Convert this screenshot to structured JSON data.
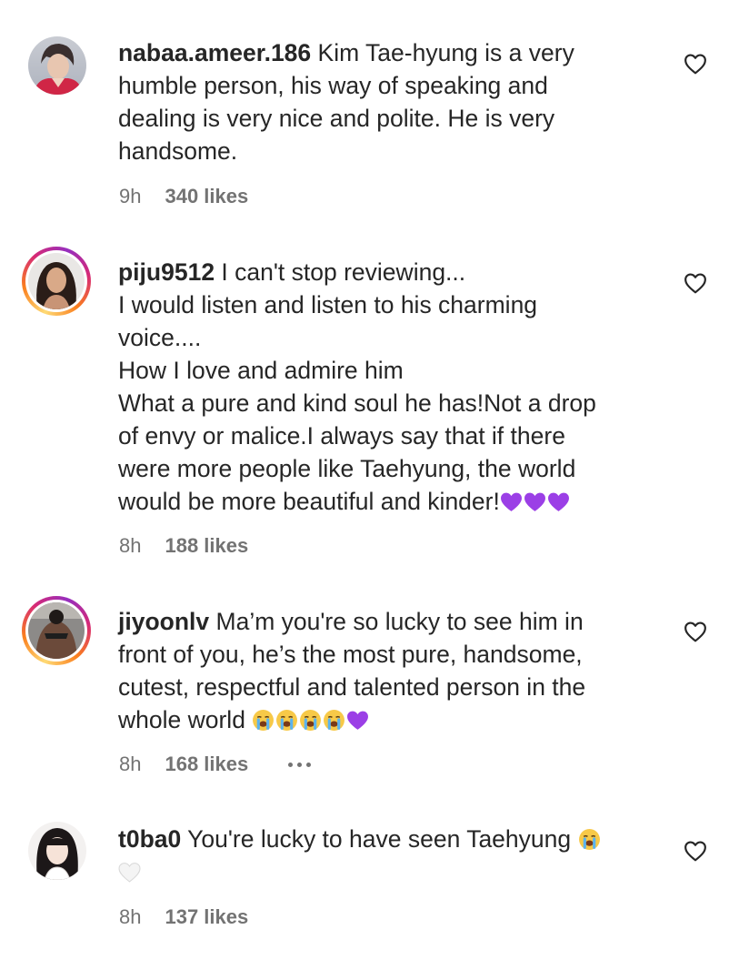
{
  "comments": [
    {
      "username": "nabaa.ameer.186",
      "lines": [
        " Kim Tae-hyung is a very",
        "humble person, his way of speaking and",
        "dealing is very nice and polite. He is very",
        "handsome."
      ],
      "time": "9h",
      "likes": "340 likes",
      "avatar_ring": false
    },
    {
      "username": "piju9512",
      "lines": [
        " I can't stop reviewing...",
        "I would listen and listen to his charming",
        "voice....",
        "How I love and admire him",
        "What a pure and kind soul he has!Not a drop",
        "of envy or malice.I always say that if there",
        "were more people like Taehyung, the world",
        "would be more beautiful and kinder!"
      ],
      "trailing_emoji": [
        "purple-heart",
        "purple-heart",
        "purple-heart"
      ],
      "time": "8h",
      "likes": "188 likes",
      "avatar_ring": true
    },
    {
      "username": "jiyoonlv",
      "lines": [
        " Ma’m you're so lucky to see him in",
        "front of you, he’s the most pure, handsome,",
        "cutest, respectful and talented person in the",
        "whole world "
      ],
      "trailing_emoji": [
        "loudly-crying-face",
        "loudly-crying-face",
        "loudly-crying-face",
        "loudly-crying-face",
        "purple-heart"
      ],
      "time": "8h",
      "likes": "168 likes",
      "avatar_ring": true,
      "has_more_menu": true
    },
    {
      "username": "t0ba0",
      "lines": [
        " You're lucky to have seen Taehyung "
      ],
      "trailing_emoji": [
        "loudly-crying-face"
      ],
      "second_line_emoji": [
        "white-heart"
      ],
      "time": "8h",
      "likes": "137 likes",
      "avatar_ring": false
    }
  ],
  "colors": {
    "text": "#262626",
    "secondary": "#737373",
    "purple_heart": "#9b3fe6"
  }
}
